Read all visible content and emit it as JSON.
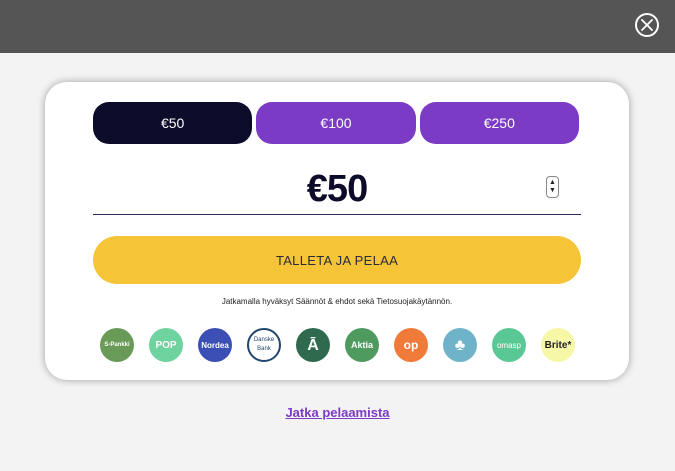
{
  "header": {
    "close_icon": "close-circle-icon"
  },
  "amount_options": [
    {
      "label": "€50",
      "selected": true
    },
    {
      "label": "€100",
      "selected": false
    },
    {
      "label": "€250",
      "selected": false
    }
  ],
  "amount_field": {
    "value": "€50"
  },
  "deposit_button": {
    "label": "TALLETA JA PELAA"
  },
  "terms_text": "Jatkamalla hyväksyt Säännöt & ehdot sekä Tietosuojakäytännön.",
  "banks": [
    {
      "label": "S-Pankki",
      "color": "#6a9a57"
    },
    {
      "label": "POP",
      "color": "#6ed39e"
    },
    {
      "label": "Nordea",
      "color": "#3b4fb5"
    },
    {
      "label": "Danske Bank",
      "color": "#22466f"
    },
    {
      "label": "Ā",
      "color": "#2f6a4f"
    },
    {
      "label": "Aktia",
      "color": "#4f9b5f"
    },
    {
      "label": "op",
      "color": "#f07a3a"
    },
    {
      "label": "♣",
      "color": "#6fb3c9"
    },
    {
      "label": "omasp",
      "color": "#5ac895"
    },
    {
      "label": "Brite*",
      "color": "#f7f7a8"
    }
  ],
  "continue_link": {
    "label": "Jatka pelaamista"
  },
  "colors": {
    "topbar": "#555555",
    "selected_amount": "#0c0c2a",
    "amount": "#7b3bc4",
    "deposit": "#f5c437",
    "link": "#7b3bc4"
  }
}
